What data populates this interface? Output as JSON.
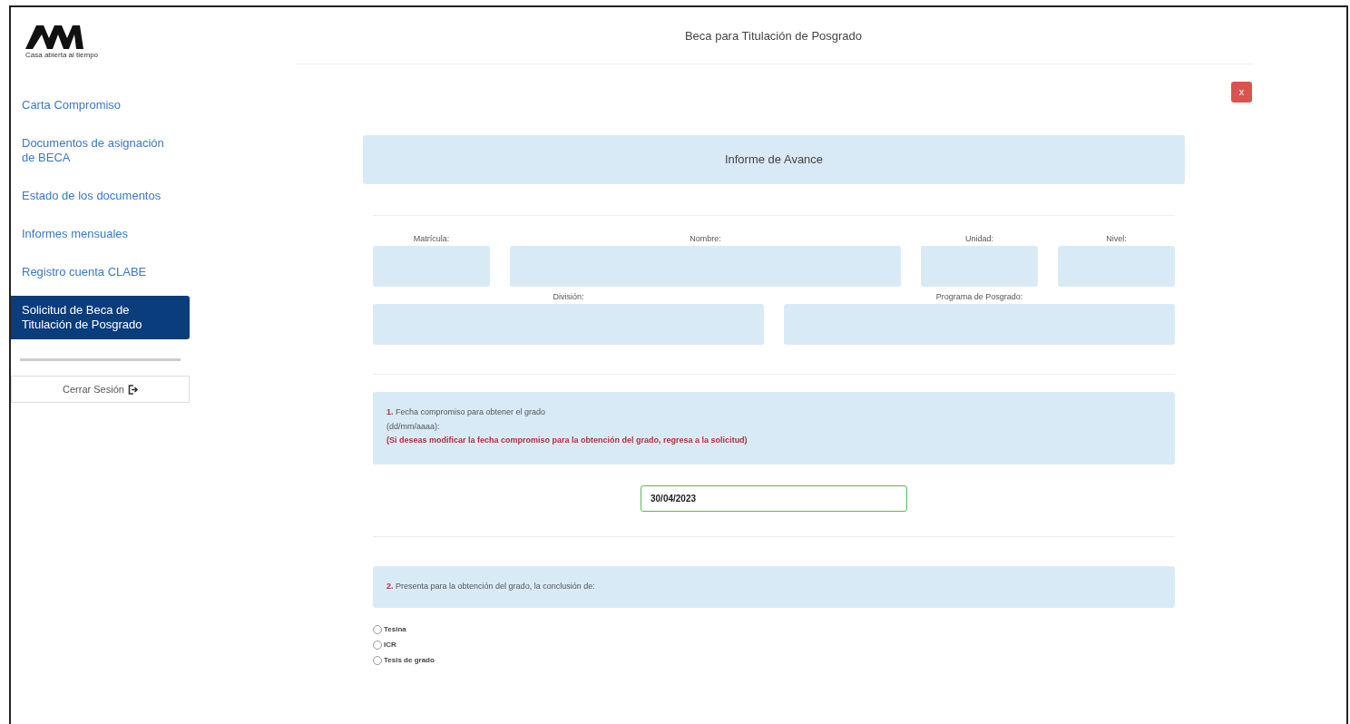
{
  "logo": {
    "tagline": "Casa abierta al tiempo"
  },
  "sidebar": {
    "items": [
      {
        "label": "Carta Compromiso",
        "selected": false
      },
      {
        "label": "Documentos de asignación de BECA",
        "selected": false
      },
      {
        "label": "Estado de los documentos",
        "selected": false
      },
      {
        "label": "Informes mensuales",
        "selected": false
      },
      {
        "label": "Registro cuenta CLABE",
        "selected": false
      },
      {
        "label": "Solicitud de Beca de Titulación de Posgrado",
        "selected": true
      }
    ],
    "logout": "Cerrar Sesión"
  },
  "header": {
    "title": "Beca para Titulación de Posgrado",
    "close": "x"
  },
  "form": {
    "banner": "Informe de Avance",
    "student_fields": [
      {
        "label": "Matrícula:"
      },
      {
        "label": "Nombre:"
      },
      {
        "label": "Unidad:"
      },
      {
        "label": "Nivel:"
      }
    ],
    "program_fields": [
      {
        "label": "División:"
      },
      {
        "label": "Programa de Posgrado:"
      }
    ],
    "section1": {
      "number": "1.",
      "text": "Fecha compromiso para obtener el grado",
      "format": "(dd/mm/aaaa):",
      "note": "(Si deseas modificar la fecha compromiso para la obtención del grado, regresa a la solicitud)"
    },
    "date": {
      "value": "30/04/2023"
    },
    "section2": {
      "number": "2.",
      "text": "Presenta para la obtención del grado, la conclusión de:"
    },
    "options": [
      {
        "label": "Tesina",
        "selected": false
      },
      {
        "label": "ICR",
        "selected": false
      },
      {
        "label": "Tesis de grado",
        "selected": false
      }
    ]
  }
}
